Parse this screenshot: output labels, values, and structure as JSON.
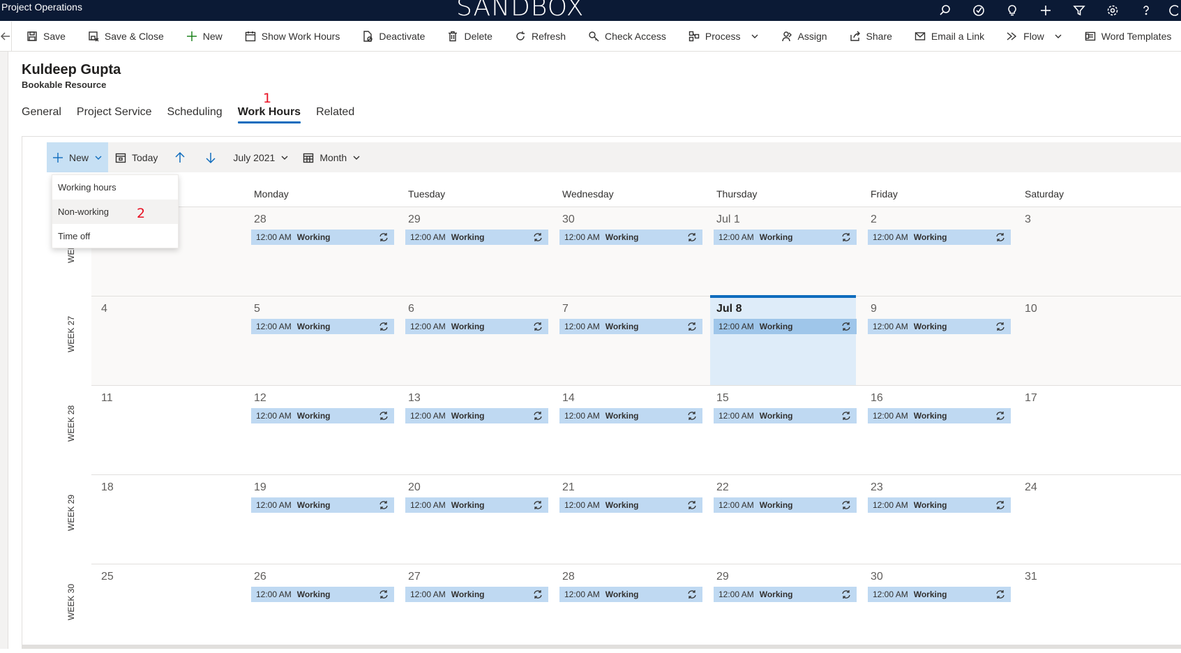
{
  "topbar": {
    "app_title": "Project Operations",
    "environment_banner": "SANDBOX",
    "icons": [
      "search-icon",
      "task-check-icon",
      "lightbulb-icon",
      "plus-icon",
      "filter-icon",
      "gear-icon",
      "help-icon",
      "user-icon"
    ]
  },
  "commands": [
    {
      "name": "save",
      "label": "Save",
      "icon": "save-icon"
    },
    {
      "name": "save-close",
      "label": "Save & Close",
      "icon": "save-close-icon"
    },
    {
      "name": "new",
      "label": "New",
      "icon": "plus-icon"
    },
    {
      "name": "show-work-hours",
      "label": "Show Work Hours",
      "icon": "calendar-icon"
    },
    {
      "name": "deactivate",
      "label": "Deactivate",
      "icon": "document-block-icon"
    },
    {
      "name": "delete",
      "label": "Delete",
      "icon": "trash-icon"
    },
    {
      "name": "refresh",
      "label": "Refresh",
      "icon": "refresh-icon"
    },
    {
      "name": "check-access",
      "label": "Check Access",
      "icon": "key-search-icon"
    },
    {
      "name": "process",
      "label": "Process",
      "icon": "process-icon",
      "chevron": true
    },
    {
      "name": "assign",
      "label": "Assign",
      "icon": "person-assign-icon"
    },
    {
      "name": "share",
      "label": "Share",
      "icon": "share-icon"
    },
    {
      "name": "email-link",
      "label": "Email a Link",
      "icon": "email-icon"
    },
    {
      "name": "flow",
      "label": "Flow",
      "icon": "flow-icon",
      "chevron": true
    },
    {
      "name": "word-templates",
      "label": "Word Templates",
      "icon": "word-template-icon",
      "chevron": true
    }
  ],
  "record": {
    "name": "Kuldeep Gupta",
    "entity": "Bookable Resource"
  },
  "tabs": [
    {
      "label": "General",
      "active": false
    },
    {
      "label": "Project Service",
      "active": false
    },
    {
      "label": "Scheduling",
      "active": false
    },
    {
      "label": "Work Hours",
      "active": true
    },
    {
      "label": "Related",
      "active": false
    }
  ],
  "annotations": {
    "one": "1",
    "two": "2"
  },
  "calendar_toolbar": {
    "new_label": "New",
    "today_label": "Today",
    "period_label": "July 2021",
    "view_label": "Month"
  },
  "new_menu": [
    "Working hours",
    "Non-working",
    "Time off"
  ],
  "day_headers": [
    "Monday",
    "Tuesday",
    "Wednesday",
    "Thursday",
    "Friday",
    "Saturday"
  ],
  "weeks": [
    {
      "label": "WEEK 26",
      "sunday": "",
      "days": [
        "28",
        "29",
        "30",
        "Jul 1",
        "2",
        "3"
      ]
    },
    {
      "label": "WEEK 27",
      "sunday": "4",
      "days": [
        "5",
        "6",
        "7",
        "Jul 8",
        "9",
        "10"
      ]
    },
    {
      "label": "WEEK 28",
      "sunday": "11",
      "days": [
        "12",
        "13",
        "14",
        "15",
        "16",
        "17"
      ]
    },
    {
      "label": "WEEK 29",
      "sunday": "18",
      "days": [
        "19",
        "20",
        "21",
        "22",
        "23",
        "24"
      ]
    },
    {
      "label": "WEEK 30",
      "sunday": "25",
      "days": [
        "26",
        "27",
        "28",
        "29",
        "30",
        "31"
      ]
    }
  ],
  "event": {
    "time": "12:00 AM",
    "status": "Working"
  },
  "today": {
    "week": 1,
    "day": 3
  },
  "colors": {
    "accent": "#0f6cbd",
    "event": "#bfd9f2",
    "topbar": "#0b1a35",
    "annotation": "#e81123"
  }
}
